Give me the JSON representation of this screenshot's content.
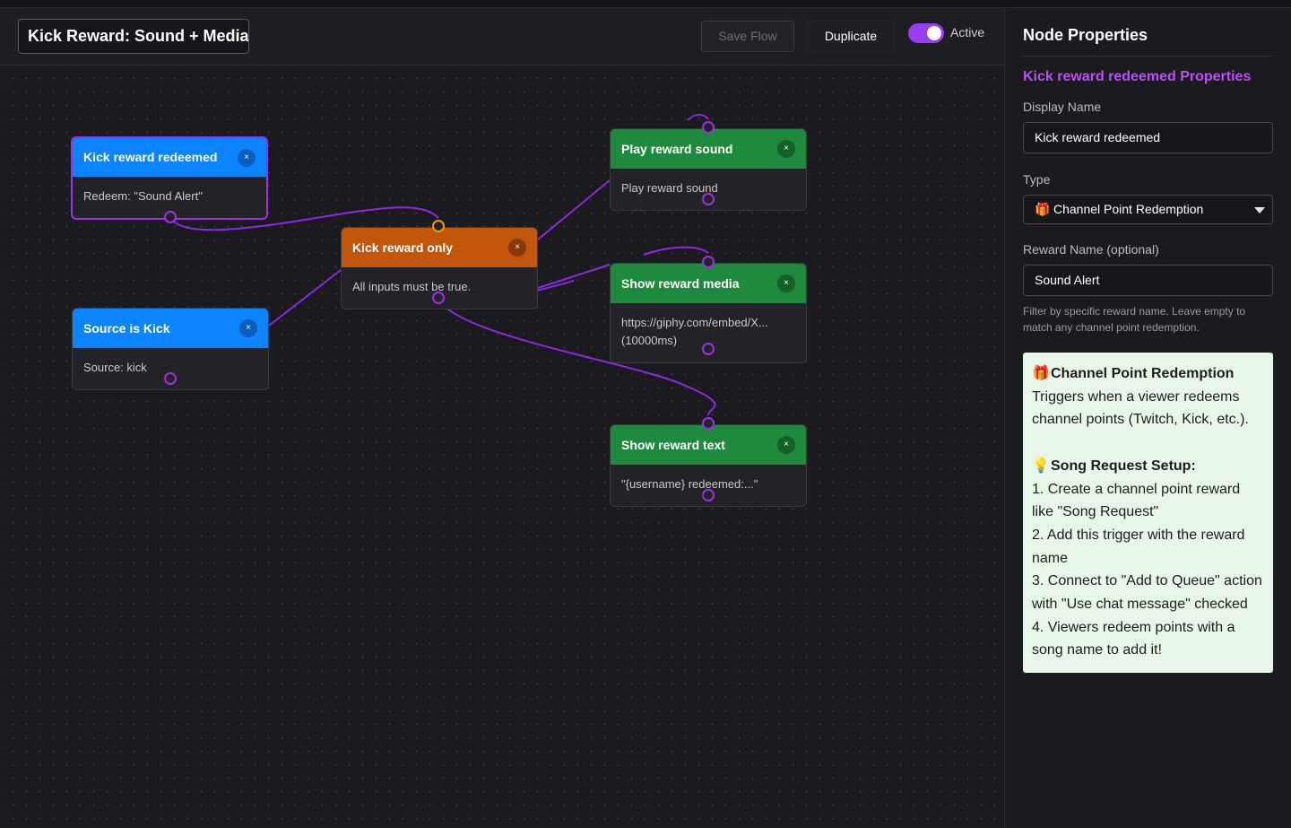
{
  "toolbar": {
    "flow_name": "Kick Reward: Sound + Media",
    "save_label": "Save Flow",
    "duplicate_label": "Duplicate",
    "active_label": "Active",
    "active": true
  },
  "nodes": {
    "kick_reward_redeemed": {
      "title": "Kick reward redeemed",
      "body": "Redeem: \"Sound Alert\"",
      "color": "#0d84ff"
    },
    "source_is_kick": {
      "title": "Source is Kick",
      "body": "Source: kick",
      "color": "#0d84ff"
    },
    "kick_reward_only": {
      "title": "Kick reward only",
      "body": "All inputs must be true.",
      "color": "#c2570c"
    },
    "play_reward_sound": {
      "title": "Play reward sound",
      "body": "Play reward sound",
      "color": "#1d8a3d"
    },
    "show_reward_media": {
      "title": "Show reward media",
      "body_line1": "https://giphy.com/embed/X...",
      "body_line2": "(10000ms)",
      "color": "#1d8a3d"
    },
    "show_reward_text": {
      "title": "Show reward text",
      "body": "\"{username} redeemed:...\"",
      "color": "#1d8a3d"
    },
    "close_glyph": "×"
  },
  "panel": {
    "title": "Node Properties",
    "subtitle": "Kick reward redeemed Properties",
    "display_name_label": "Display Name",
    "display_name_value": "Kick reward redeemed",
    "type_label": "Type",
    "type_value": "Channel Point Redemption",
    "reward_name_label": "Reward Name (optional)",
    "reward_name_value": "Sound Alert",
    "hint": "Filter by specific reward name. Leave empty to match any channel point redemption.",
    "info": {
      "heading": "Channel Point Redemption",
      "description": "Triggers when a viewer redeems channel points (Twitch, Kick, etc.).",
      "setup_heading": "Song Request Setup:",
      "steps": [
        "1. Create a channel point reward like \"Song Request\"",
        "2. Add this trigger with the reward name",
        "3. Connect to \"Add to Queue\" action with \"Use chat message\" checked",
        "4. Viewers redeem points with a song name to add it!"
      ],
      "gift_icon": "🎁",
      "bulb_icon": "💡"
    }
  },
  "colors": {
    "accent": "#9b30e6",
    "trigger": "#0d84ff",
    "logic": "#c2570c",
    "action": "#1d8a3d"
  }
}
